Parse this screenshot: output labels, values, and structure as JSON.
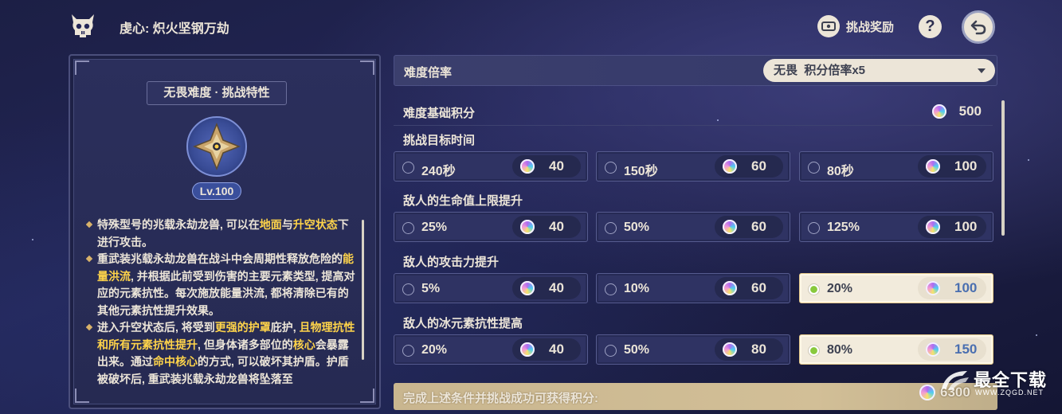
{
  "header": {
    "title": "虔心: 炽火坚钢万劫",
    "reward_label": "挑战奖励",
    "help_label": "?"
  },
  "left_panel": {
    "title": "无畏难度 · 挑战特性",
    "level": "Lv.100",
    "paragraphs": [
      [
        {
          "t": "特殊型号的兆载永劫龙兽, 可以在",
          "h": false
        },
        {
          "t": "地面",
          "h": true
        },
        {
          "t": "与",
          "h": false
        },
        {
          "t": "升空状态",
          "h": true
        },
        {
          "t": "下进行攻击。",
          "h": false
        }
      ],
      [
        {
          "t": "重武装兆载永劫龙兽在战斗中会周期性释放危险的",
          "h": false
        },
        {
          "t": "能量洪流",
          "h": true
        },
        {
          "t": ", 并根据此前受到伤害的主要元素类型, 提高对应的元素抗性。每次施放能量洪流, 都将清除已有的其他元素抗性提升效果。",
          "h": false
        }
      ],
      [
        {
          "t": "进入升空状态后, 将受到",
          "h": false
        },
        {
          "t": "更强的护罩",
          "h": true
        },
        {
          "t": "庇护, ",
          "h": false
        },
        {
          "t": "且物理抗性和所有元素抗性提升",
          "h": true
        },
        {
          "t": ", 但身体诸多部位的",
          "h": false
        },
        {
          "t": "核心",
          "h": true
        },
        {
          "t": "会暴露出来。通过",
          "h": false
        },
        {
          "t": "命中核心",
          "h": true
        },
        {
          "t": "的方式, 可以破坏其护盾。护盾被破坏后, 重武装兆载永劫龙兽将坠落至",
          "h": false
        }
      ]
    ]
  },
  "difficulty": {
    "label": "难度倍率",
    "selected": "无畏  积分倍率x5"
  },
  "base_score": {
    "label": "难度基础积分",
    "value": "500"
  },
  "sections": [
    {
      "label": "挑战目标时间",
      "options": [
        {
          "label": "240秒",
          "points": "40",
          "selected": false
        },
        {
          "label": "150秒",
          "points": "60",
          "selected": false
        },
        {
          "label": "80秒",
          "points": "100",
          "selected": false
        }
      ]
    },
    {
      "label": "敌人的生命值上限提升",
      "options": [
        {
          "label": "25%",
          "points": "40",
          "selected": false
        },
        {
          "label": "50%",
          "points": "60",
          "selected": false
        },
        {
          "label": "125%",
          "points": "100",
          "selected": false
        }
      ]
    },
    {
      "label": "敌人的攻击力提升",
      "options": [
        {
          "label": "5%",
          "points": "40",
          "selected": false
        },
        {
          "label": "10%",
          "points": "60",
          "selected": false
        },
        {
          "label": "20%",
          "points": "100",
          "selected": true
        }
      ]
    },
    {
      "label": "敌人的冰元素抗性提高",
      "options": [
        {
          "label": "20%",
          "points": "40",
          "selected": false
        },
        {
          "label": "50%",
          "points": "80",
          "selected": false
        },
        {
          "label": "80%",
          "points": "150",
          "selected": true
        }
      ]
    }
  ],
  "total": {
    "label": "完成上述条件并挑战成功可获得积分:",
    "value": "6300"
  },
  "watermark": {
    "name": "最全下载",
    "url": "WWW.ZQGD.NET"
  },
  "colors": {
    "accent_highlight": "#ffd44a",
    "panel_bg": "#2b2f5c",
    "selected_bg": "#f2ebdc",
    "radio_selected": "#88c93d"
  }
}
